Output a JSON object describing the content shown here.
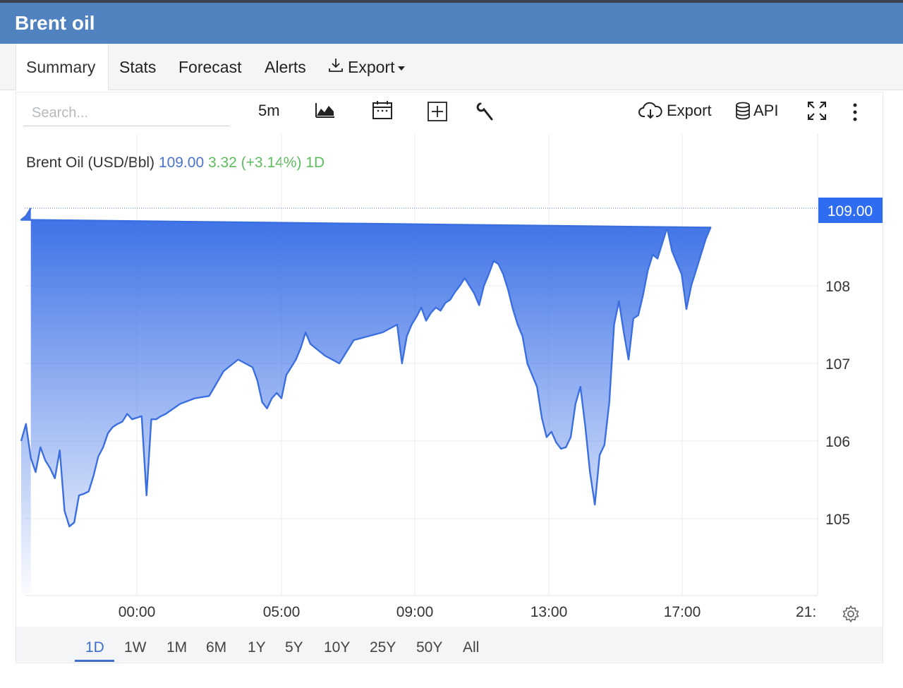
{
  "window": {
    "title": "Brent oil"
  },
  "tabs": [
    {
      "label": "Summary",
      "active": true
    },
    {
      "label": "Stats"
    },
    {
      "label": "Forecast"
    },
    {
      "label": "Alerts"
    },
    {
      "label": "Export"
    }
  ],
  "toolbar": {
    "search_placeholder": "Search...",
    "interval": "5m",
    "export_label": "Export",
    "api_label": "API",
    "icons": [
      "area-chart-icon",
      "calendar-icon",
      "crosshair-icon",
      "wrench-icon",
      "cloud-download-icon",
      "database-icon",
      "fullscreen-icon",
      "more-vertical-icon",
      "download-icon",
      "gear-icon"
    ]
  },
  "legend": {
    "name": "Brent Oil (USD/Bbl)",
    "price": "109.00",
    "change": "3.32 (+3.14%) 1D"
  },
  "ranges": [
    "1D",
    "1W",
    "1M",
    "6M",
    "1Y",
    "5Y",
    "10Y",
    "25Y",
    "50Y",
    "All"
  ],
  "active_range": "1D",
  "colors": {
    "header": "#4f82bf",
    "line": "#3b6fe0",
    "fill_top": "#3a6fe6",
    "price_label_bg": "#2e6cf0",
    "positive": "#5fbb5f"
  },
  "chart_data": {
    "type": "area",
    "x_ticks": [
      "00:00",
      "05:00",
      "09:00",
      "13:00",
      "17:00",
      "21:"
    ],
    "y_ticks": [
      105,
      106,
      107,
      108
    ],
    "ylim": [
      104.0,
      109.5
    ],
    "last_price_label": "109.00",
    "grid": true,
    "x": [
      "20:00",
      "20:10",
      "20:20",
      "20:30",
      "20:40",
      "20:50",
      "21:00",
      "21:10",
      "21:20",
      "21:30",
      "21:40",
      "21:50",
      "22:00",
      "22:10",
      "22:20",
      "22:30",
      "22:40",
      "22:50",
      "23:00",
      "23:10",
      "23:20",
      "23:30",
      "23:40",
      "23:50",
      "00:00",
      "00:10",
      "00:20",
      "00:30",
      "00:40",
      "00:50",
      "01:00",
      "01:30",
      "02:00",
      "02:30",
      "03:00",
      "03:30",
      "04:00",
      "04:10",
      "04:20",
      "04:30",
      "04:40",
      "04:50",
      "05:00",
      "05:10",
      "05:20",
      "05:30",
      "05:40",
      "05:50",
      "06:00",
      "06:30",
      "07:00",
      "07:30",
      "08:00",
      "08:30",
      "09:00",
      "09:10",
      "09:20",
      "09:30",
      "09:40",
      "09:50",
      "10:00",
      "10:10",
      "10:20",
      "10:30",
      "10:40",
      "10:50",
      "11:00",
      "11:10",
      "11:20",
      "11:30",
      "11:40",
      "11:50",
      "12:00",
      "12:10",
      "12:20",
      "12:30",
      "12:40",
      "12:50",
      "13:00",
      "13:10",
      "13:20",
      "13:30",
      "13:40",
      "13:50",
      "14:00",
      "14:10",
      "14:20",
      "14:30",
      "14:40",
      "14:50",
      "15:00",
      "15:10",
      "15:20",
      "15:30",
      "15:40",
      "15:50",
      "16:00",
      "16:10",
      "16:20",
      "16:30",
      "16:40",
      "16:50",
      "17:00",
      "17:10",
      "17:20",
      "17:30",
      "17:40",
      "17:50",
      "18:00",
      "18:10",
      "18:20",
      "18:30",
      "18:40",
      "18:50",
      "19:00",
      "19:10",
      "19:20",
      "19:30",
      "19:40",
      "19:50",
      "20:00",
      "20:10",
      "20:20"
    ],
    "values": [
      106.0,
      106.22,
      105.78,
      105.6,
      105.92,
      105.75,
      105.65,
      105.52,
      105.88,
      105.1,
      104.9,
      104.95,
      105.3,
      105.32,
      105.35,
      105.55,
      105.8,
      105.92,
      106.1,
      106.18,
      106.22,
      106.25,
      106.35,
      106.28,
      106.3,
      106.32,
      105.3,
      106.28,
      106.28,
      106.32,
      106.35,
      106.48,
      106.55,
      106.58,
      106.9,
      107.05,
      106.95,
      106.78,
      106.5,
      106.42,
      106.55,
      106.62,
      106.55,
      106.85,
      106.95,
      107.05,
      107.2,
      107.4,
      107.25,
      107.1,
      107.0,
      107.3,
      107.35,
      107.4,
      107.5,
      107.0,
      107.35,
      107.5,
      107.6,
      107.72,
      107.55,
      107.65,
      107.72,
      107.68,
      107.78,
      107.82,
      107.92,
      108.0,
      108.1,
      108.0,
      107.9,
      107.75,
      108.0,
      108.15,
      108.32,
      108.28,
      108.15,
      107.95,
      107.7,
      107.5,
      107.35,
      107.0,
      106.85,
      106.7,
      106.3,
      106.05,
      106.12,
      105.98,
      105.9,
      105.92,
      106.05,
      106.48,
      106.7,
      106.2,
      105.6,
      105.18,
      105.82,
      105.95,
      106.5,
      107.5,
      107.8,
      107.4,
      107.05,
      107.58,
      107.62,
      107.88,
      108.2,
      108.4,
      108.35,
      108.55,
      108.75,
      108.45,
      108.3,
      108.15,
      107.7,
      108.0,
      108.2,
      108.4,
      108.6,
      108.75,
      108.85,
      108.9,
      109.0
    ]
  },
  "chart_settings_icon": "gear-icon"
}
